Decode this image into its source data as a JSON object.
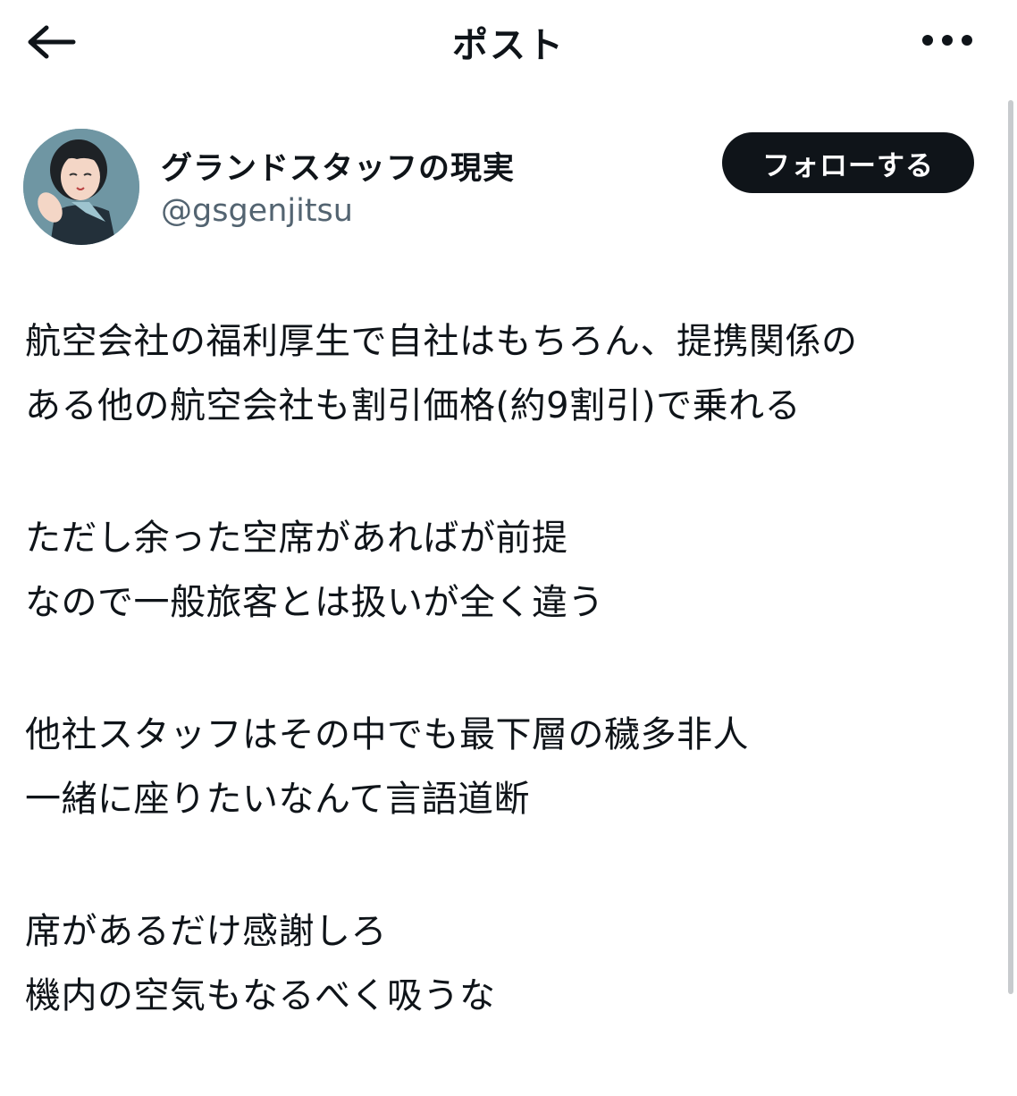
{
  "header": {
    "title": "ポスト",
    "back_icon": "arrow-left-icon",
    "more_icon": "more-horizontal-icon"
  },
  "author": {
    "display_name": "グランドスタッフの現実",
    "handle": "@gsgenjitsu",
    "follow_label": "フォローする"
  },
  "post": {
    "paragraphs": [
      [
        "航空会社の福利厚生で自社はもちろん、提携関係の",
        "ある他の航空会社も割引価格(約9割引)で乗れる"
      ],
      [
        "ただし余った空席があればが前提",
        "なので一般旅客とは扱いが全く違う"
      ],
      [
        "他社スタッフはその中でも最下層の穢多非人",
        "一緒に座りたいなんて言語道断"
      ],
      [
        "席があるだけ感謝しろ",
        "機内の空気もなるべく吸うな"
      ]
    ]
  },
  "colors": {
    "text": "#0f1419",
    "secondary_text": "#536471",
    "button_bg": "#0f1419",
    "button_text": "#ffffff",
    "avatar_bg": "#6f96a3"
  }
}
